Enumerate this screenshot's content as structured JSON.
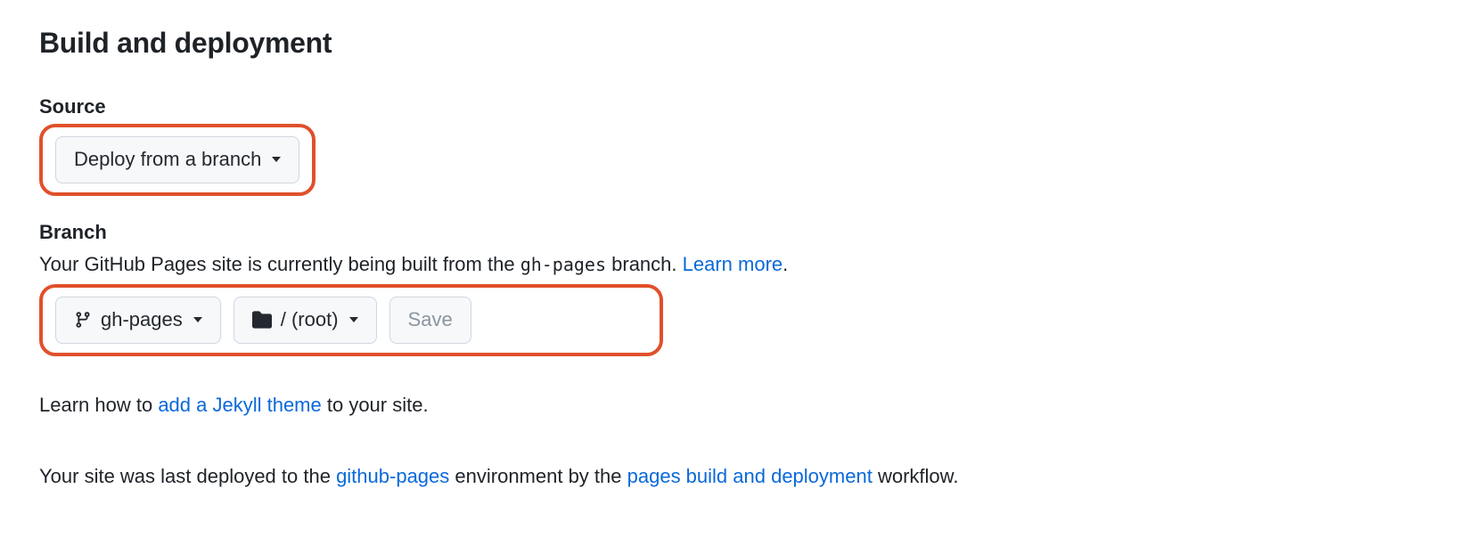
{
  "heading": "Build and deployment",
  "source": {
    "label": "Source",
    "button_label": "Deploy from a branch"
  },
  "branch": {
    "label": "Branch",
    "desc_prefix": "Your GitHub Pages site is currently being built from the ",
    "desc_branch_code": "gh-pages",
    "desc_suffix": " branch. ",
    "learn_more": "Learn more",
    "desc_period": ".",
    "branch_button": "gh-pages",
    "folder_button": "/ (root)",
    "save_button": "Save"
  },
  "jekyll": {
    "prefix": "Learn how to ",
    "link": "add a Jekyll theme",
    "suffix": " to your site."
  },
  "deploy": {
    "prefix": "Your site was last deployed to the ",
    "env_link": "github-pages",
    "mid": " environment by the ",
    "workflow_link": "pages build and deployment",
    "suffix": " workflow."
  }
}
